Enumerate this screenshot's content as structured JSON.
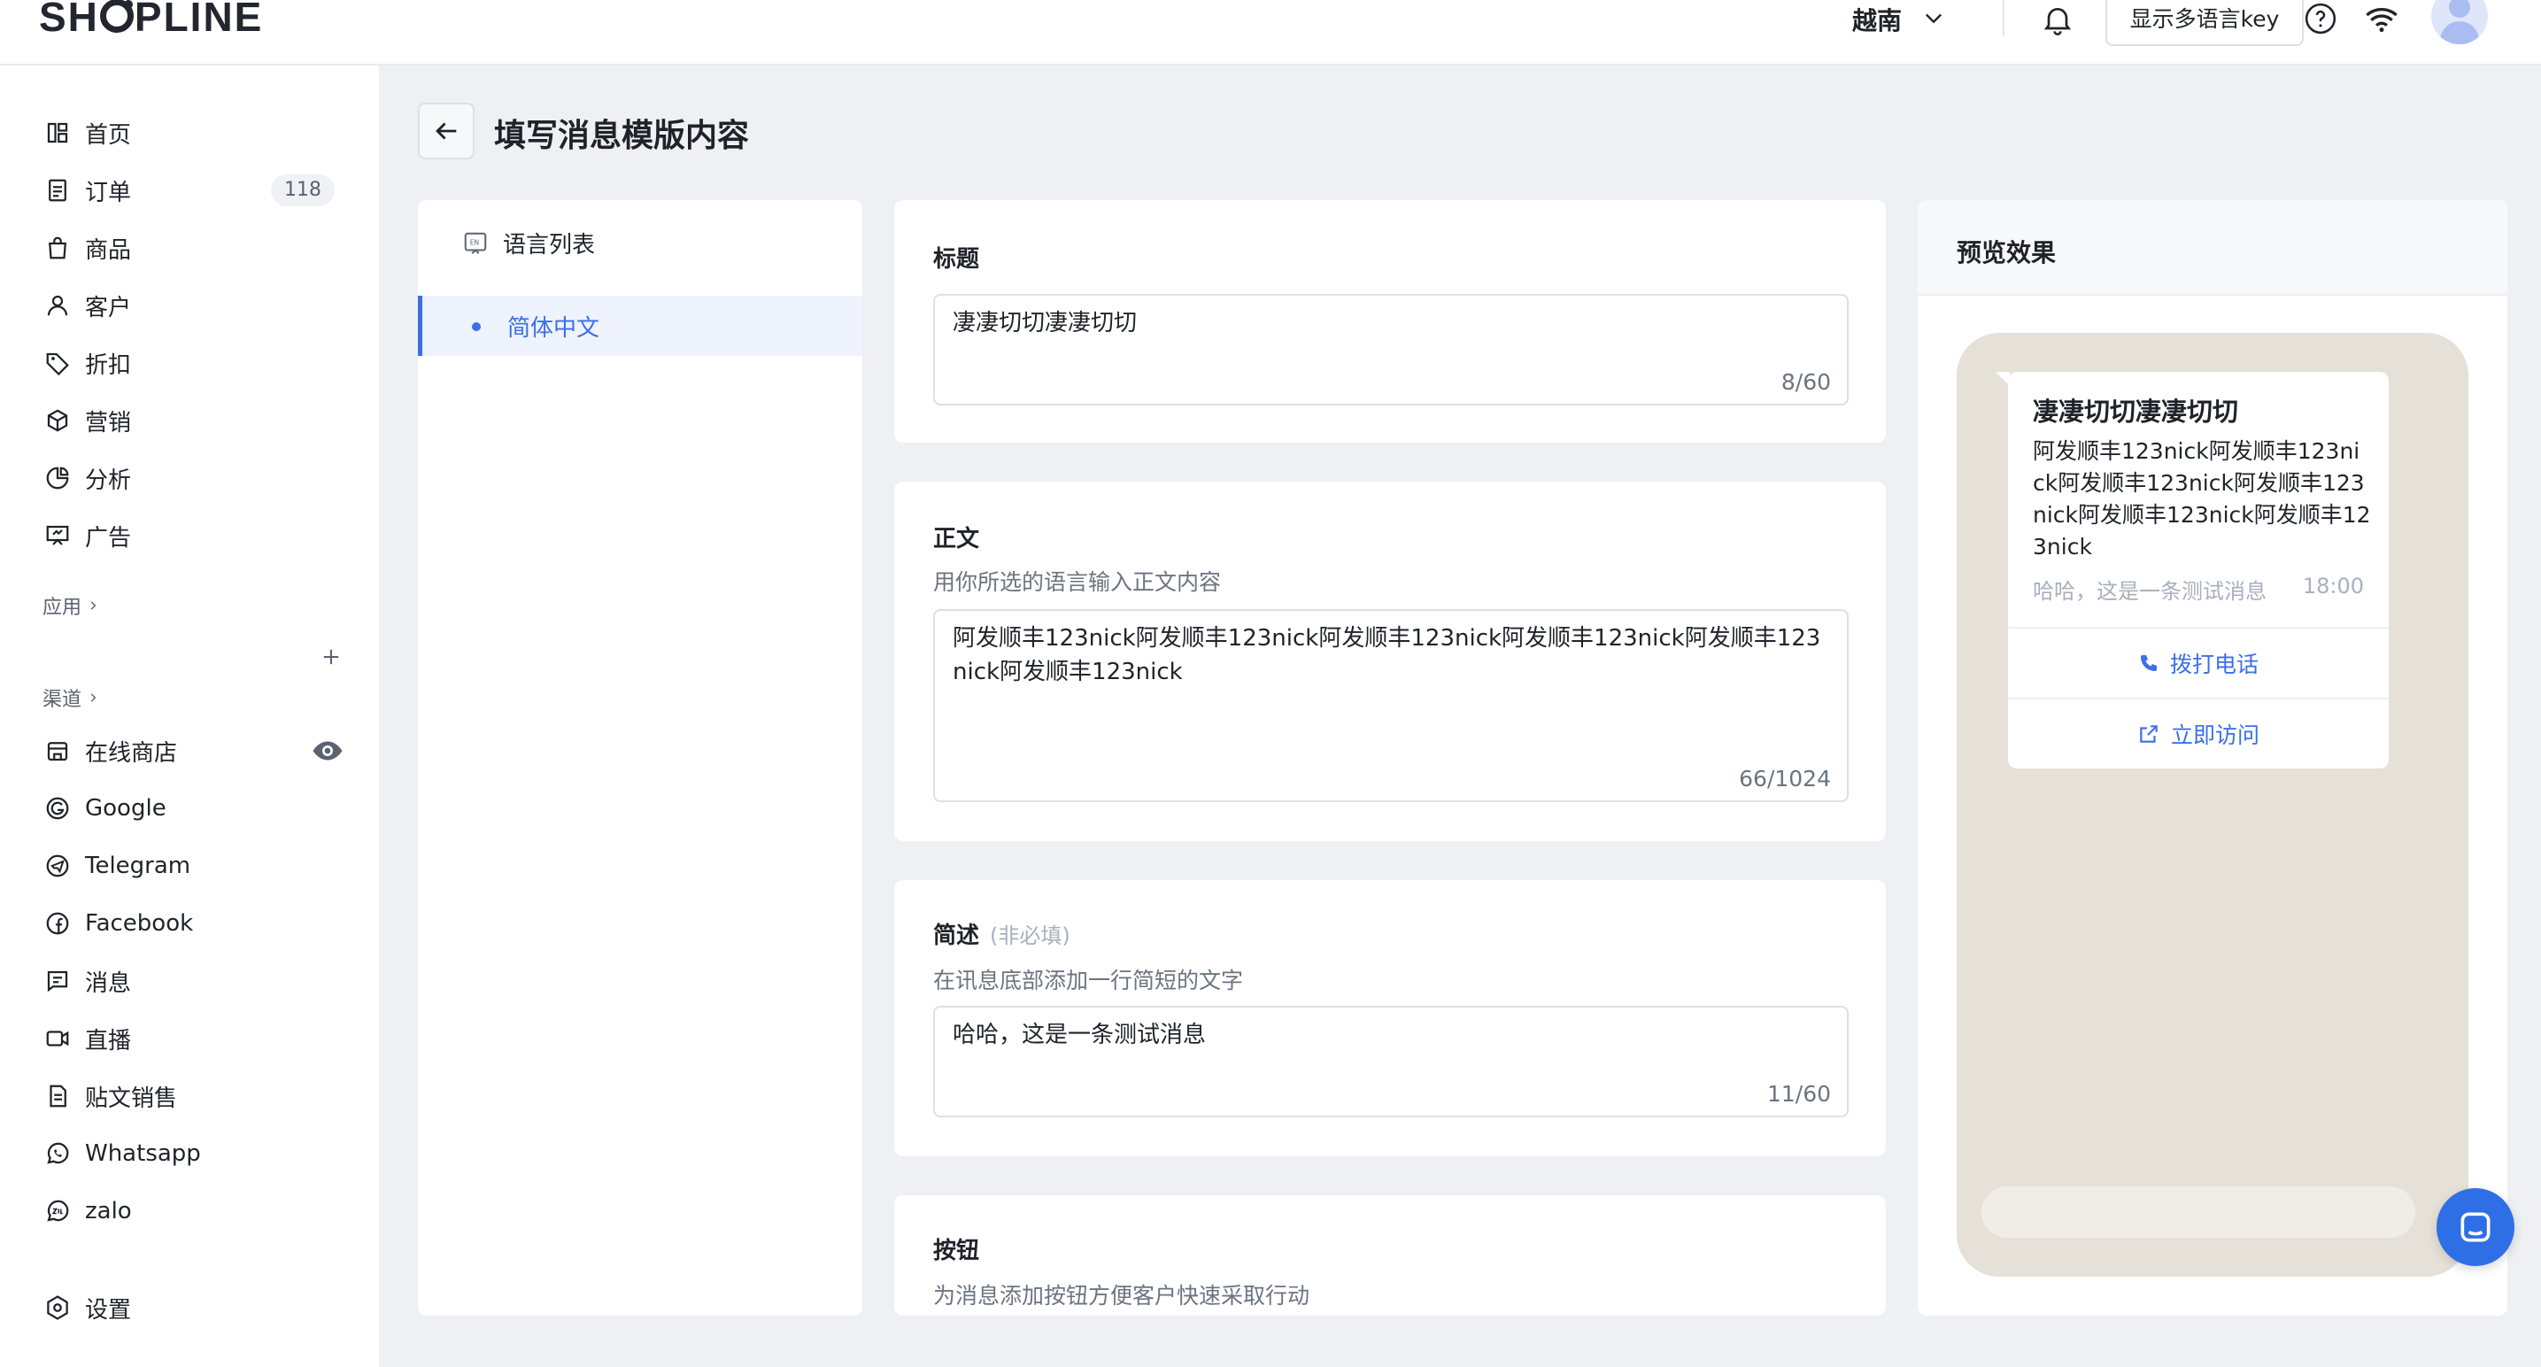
{
  "topbar": {
    "logo": "SHOPLINE",
    "country": "越南",
    "lang_key_button": "显示多语言key"
  },
  "sidebar": {
    "items": [
      {
        "label": "首页",
        "icon": "home-icon"
      },
      {
        "label": "订单",
        "icon": "order-icon",
        "badge": "118"
      },
      {
        "label": "商品",
        "icon": "bag-icon"
      },
      {
        "label": "客户",
        "icon": "user-icon"
      },
      {
        "label": "折扣",
        "icon": "tag-icon"
      },
      {
        "label": "营销",
        "icon": "cube-icon"
      },
      {
        "label": "分析",
        "icon": "pie-icon"
      },
      {
        "label": "广告",
        "icon": "ad-icon"
      }
    ],
    "apps_label": "应用",
    "channels_label": "渠道",
    "channels": [
      {
        "label": "在线商店",
        "icon": "store-icon"
      },
      {
        "label": "Google",
        "icon": "google-icon"
      },
      {
        "label": "Telegram",
        "icon": "telegram-icon"
      },
      {
        "label": "Facebook",
        "icon": "facebook-icon"
      },
      {
        "label": "消息",
        "icon": "message-icon"
      },
      {
        "label": "直播",
        "icon": "live-icon"
      },
      {
        "label": "贴文销售",
        "icon": "post-icon"
      },
      {
        "label": "Whatsapp",
        "icon": "whatsapp-icon"
      },
      {
        "label": "zalo",
        "icon": "zalo-icon"
      }
    ],
    "settings_label": "设置"
  },
  "page": {
    "title": "填写消息模版内容"
  },
  "language_list": {
    "header": "语言列表",
    "items": [
      "简体中文"
    ]
  },
  "form": {
    "title": {
      "label": "标题",
      "value": "凄凄切切凄凄切切",
      "count": "8/60"
    },
    "body": {
      "label": "正文",
      "description": "用你所选的语言输入正文内容",
      "value": "阿发顺丰123nick阿发顺丰123nick阿发顺丰123nick阿发顺丰123nick阿发顺丰123nick阿发顺丰123nick",
      "count": "66/1024"
    },
    "footer": {
      "label": "简述",
      "optional": "(非必填)",
      "description": "在讯息底部添加一行简短的文字",
      "value": "哈哈，这是一条测试消息",
      "count": "11/60"
    },
    "buttons": {
      "label": "按钮",
      "description": "为消息添加按钮方便客户快速采取行动"
    }
  },
  "preview": {
    "header": "预览效果",
    "title": "凄凄切切凄凄切切",
    "body": "阿发顺丰123nick阿发顺丰123nick阿发顺丰123nick阿发顺丰123nick阿发顺丰123nick阿发顺丰123nick",
    "footer": "哈哈，这是一条测试消息",
    "time": "18:00",
    "call_button": "拨打电话",
    "visit_button": "立即访问"
  },
  "colors": {
    "accent": "#3b6fe8",
    "page_bg": "#eef0f4",
    "chat_bg": "#e6e1d8"
  }
}
